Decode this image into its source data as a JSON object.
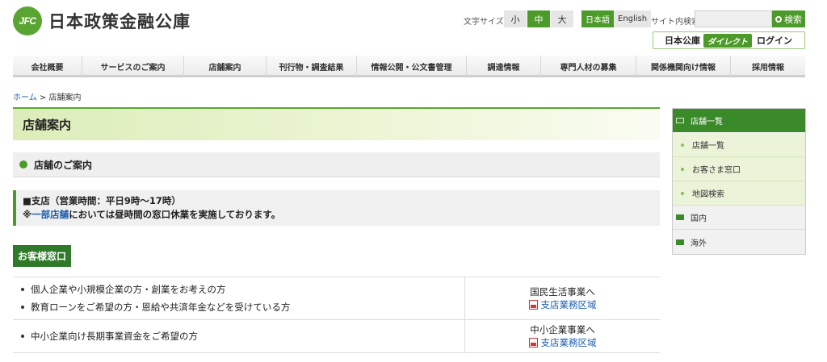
{
  "header": {
    "logo_mark": "JFC",
    "logo_text": "日本政策金融公庫",
    "font_size_label": "文字サイズ",
    "font_sizes": [
      "小",
      "中",
      "大"
    ],
    "languages": [
      "日本語",
      "English"
    ],
    "search_label": "サイト内検索",
    "search_placeholder": "",
    "search_button": "検索",
    "direct_prefix": "日本公庫",
    "direct_tag": "ダイレクト",
    "direct_login": "ログイン"
  },
  "nav": [
    "会社概要",
    "サービスのご案内",
    "店舗案内",
    "刊行物・調査結果",
    "情報公開・公文書管理",
    "調達情報",
    "専門人材の募集",
    "関係機関向け情報",
    "採用情報"
  ],
  "breadcrumb": {
    "home": "ホーム",
    "sep": ">",
    "current": "店舗案内"
  },
  "main": {
    "title": "店舗案内",
    "section": "店舗のご案内",
    "notice_line1": "■支店（営業時間：平日9時〜17時）",
    "notice_prefix": "※",
    "notice_link": "一部店舗",
    "notice_suffix": "においては昼時間の窓口休業を実施しております。",
    "green_label": "お客様窓口",
    "rows": [
      {
        "items": [
          "個人企業や小規模企業の方・創業をお考えの方",
          "教育ローンをご希望の方・恩給や共済年金などを受けている方"
        ],
        "dept": "国民生活事業へ",
        "link": "支店業務区域"
      },
      {
        "items": [
          "中小企業向け長期事業資金をご希望の方"
        ],
        "dept": "中小企業事業へ",
        "link": "支店業務区域"
      }
    ]
  },
  "side": {
    "head": "店舗一覧",
    "subs": [
      "店舗一覧",
      "お客さま窓口",
      "地図検索"
    ],
    "plain": [
      "国内",
      "海外"
    ]
  },
  "colors": {
    "brand_green": "#4c9a2a",
    "link_blue": "#1a5cb0"
  }
}
